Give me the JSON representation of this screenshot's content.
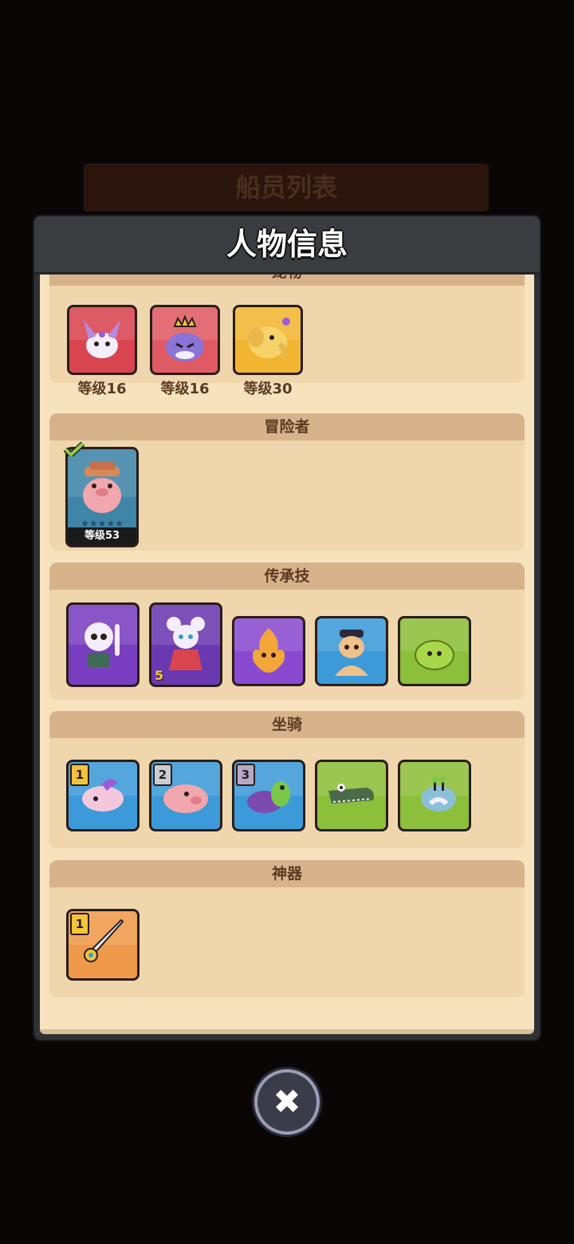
{
  "background": {
    "banner_title": "船员列表"
  },
  "modal": {
    "title": "人物信息"
  },
  "sections": {
    "pets": {
      "title": "宠物",
      "items": [
        {
          "name": "purple-fox-pet",
          "level": "等级16",
          "color": "#d8454f"
        },
        {
          "name": "crowned-slime-pet",
          "level": "等级16",
          "color": "#e05a63"
        },
        {
          "name": "yellow-elephant-pet",
          "level": "等级30",
          "color": "#f2b532"
        }
      ]
    },
    "adventurer": {
      "title": "冒险者",
      "item": {
        "name": "pig-adventurer",
        "level": "等级53",
        "stars": "★★★★★",
        "selected": true
      }
    },
    "legacy_skills": {
      "title": "传承技",
      "items": [
        {
          "name": "skeleton-skill",
          "tag": ""
        },
        {
          "name": "mouse-girl-skill",
          "tag": "5"
        },
        {
          "name": "flame-bird-skill",
          "tag": ""
        },
        {
          "name": "brawler-skill",
          "tag": ""
        },
        {
          "name": "green-slime-skill",
          "tag": ""
        }
      ]
    },
    "mounts": {
      "title": "坐骑",
      "items": [
        {
          "name": "axolotl-mount",
          "badge": "1"
        },
        {
          "name": "pig-mount",
          "badge": "2"
        },
        {
          "name": "turtle-mount",
          "badge": "3"
        },
        {
          "name": "crocodile-mount",
          "badge": ""
        },
        {
          "name": "snail-mount",
          "badge": ""
        }
      ]
    },
    "artifacts": {
      "title": "神器",
      "items": [
        {
          "name": "sword-artifact",
          "badge": "1"
        }
      ]
    }
  }
}
